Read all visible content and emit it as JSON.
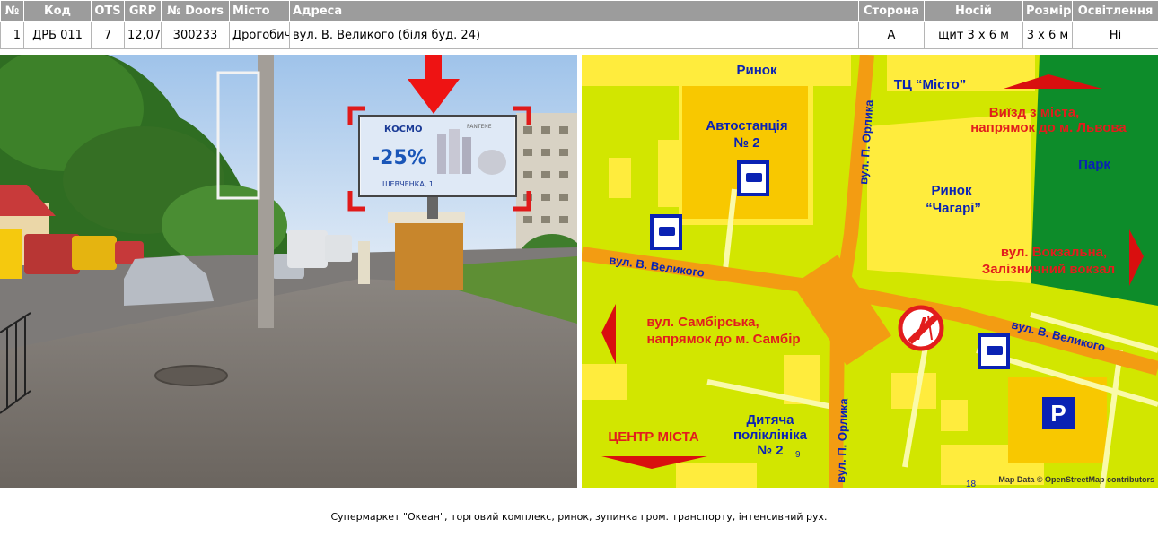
{
  "table": {
    "headers": [
      "№",
      "Код",
      "OTS",
      "GRP",
      "№ Doors",
      "Місто",
      "Адреса",
      "Сторона",
      "Носій",
      "Розмір",
      "Освітлення"
    ],
    "row": [
      "1",
      "ДРБ 011",
      "7",
      "12,07",
      "300233",
      "Дрогобич",
      "вул. В. Великого (біля буд. 24)",
      "А",
      "щит 3 х 6 м",
      "3 х 6 м",
      "Ні"
    ]
  },
  "photo": {
    "billboard_brand": "КОСМО",
    "billboard_discount": "-25%",
    "billboard_address": "ШЕВЧЕНКА, 1",
    "billboard_product": "PANTENE"
  },
  "map": {
    "labels": {
      "rynok": "Ринок",
      "tc_misto": "ТЦ “Місто”",
      "avtostantsia_1": "Автостанція",
      "avtostantsia_2": "№ 2",
      "vyizd_1": "Виїзд з міста,",
      "vyizd_2": "напрямок до м. Львова",
      "park": "Парк",
      "chagari_1": "Ринок",
      "chagari_2": "“Чагарі”",
      "vokzalna_1": "вул. Вокзальна,",
      "vokzalna_2": "Залізничний вокзал",
      "velykoho_west": "вул. В. Великого",
      "velykoho_east": "вул. В. Великого",
      "orlyka_north": "вул. П. Орлика",
      "orlyka_south": "вул. П. Орлика",
      "sambirska_1": "вул. Самбірська,",
      "sambirska_2": "напрямок до м. Самбір",
      "centre": "ЦЕНТР МІСТА",
      "polyclinic_1": "Дитяча",
      "polyclinic_2": "поліклініка",
      "polyclinic_3": "№ 2",
      "num_9": "9",
      "num_18": "18",
      "credits": "Map Data © OpenStreetMap contributors",
      "parking": "P"
    },
    "colors": {
      "background": "#d2e600",
      "building": "#ffec3d",
      "building_dark": "#f8c800",
      "road_main": "#f39c12",
      "road_minor": "#fafaaa",
      "park": "#0d8c2a",
      "label_blue": "#0a22b4",
      "label_red": "#e21d1d",
      "arrow_red": "#d90f0f"
    }
  },
  "caption": "Супермаркет \"Океан\", торговий комплекс, ринок, зупинка гром. транспорту, інтенсивний рух."
}
